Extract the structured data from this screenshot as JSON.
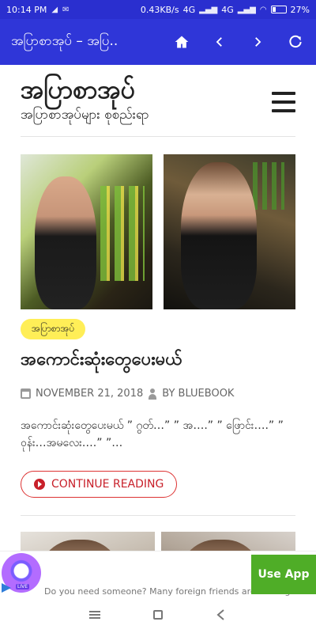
{
  "status_bar": {
    "time": "10:14 PM",
    "network_speed": "0.43KB/s",
    "signal_1": "4G",
    "signal_2": "4G",
    "battery": "27%",
    "battery_level": 0.27
  },
  "app_bar": {
    "title": "အပြာစာအုပ် – အပြ..",
    "home_icon": "home-icon",
    "back_icon": "chevron-left-icon",
    "forward_icon": "chevron-right-icon",
    "refresh_icon": "refresh-icon",
    "color": "#2f36d8"
  },
  "site": {
    "title": "အပြာစာအုပ်",
    "subtitle": "အပြာစာအုပ်များ စုစည်းရာ",
    "menu_icon": "hamburger-menu-icon"
  },
  "post": {
    "category": "အပြာစာအုပ်",
    "title": "အကောင်းဆုံးတွေပေးမယ်",
    "date": "NOVEMBER 21, 2018",
    "author": "BY BLUEBOOK",
    "excerpt": "အကောင်းဆုံးတွေပေးမယ် ” ဂွတ်…” ” အ….” ” ဖြောင်း….” ” ဝုန်း…အမလေး….” ”…",
    "continue_label": "CONTINUE READING",
    "category_color": "#ffee57",
    "accent_color": "#c8202a"
  },
  "ad": {
    "text": "Do you need someone? Many foreign friends are waiting",
    "cta": "Use App",
    "live_badge": "LIVE",
    "cta_color": "#4fad27"
  },
  "nav": {
    "menu_icon": "recent-apps-icon",
    "home_icon": "home-square-icon",
    "back_icon": "back-icon"
  }
}
